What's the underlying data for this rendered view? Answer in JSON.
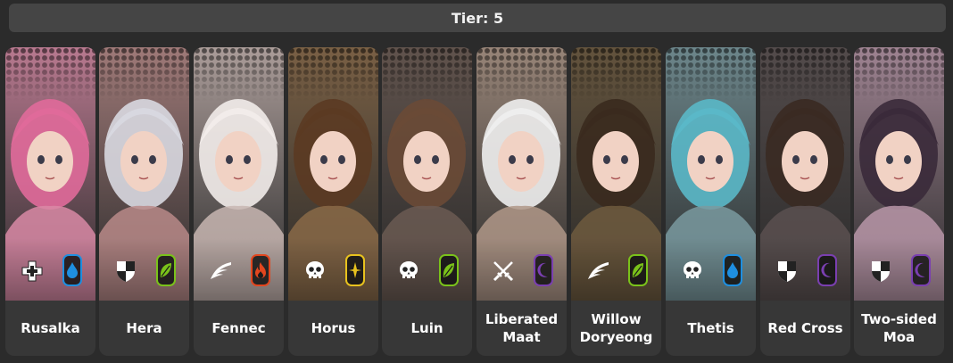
{
  "tier_label": "Tier: 5",
  "characters": [
    {
      "name": "Rusalka",
      "role_icon": "cross-icon",
      "element_icon": "water-drop-icon",
      "element_color": "#1e8fe0",
      "tint": "#d98aa6",
      "hair": "#e06a9a"
    },
    {
      "name": "Hera",
      "role_icon": "half-shield-icon",
      "element_icon": "leaf-icon",
      "element_color": "#7ac21a",
      "tint": "#b98a88",
      "hair": "#d8d8e0"
    },
    {
      "name": "Fennec",
      "role_icon": "wing-icon",
      "element_icon": "fire-icon",
      "element_color": "#e2461e",
      "tint": "#c8b6b2",
      "hair": "#f2ecea"
    },
    {
      "name": "Horus",
      "role_icon": "skull-icon",
      "element_icon": "star-icon",
      "element_color": "#e8c21e",
      "tint": "#8a6a48",
      "hair": "#5b3a22"
    },
    {
      "name": "Luin",
      "role_icon": "skull-icon",
      "element_icon": "leaf-icon",
      "element_color": "#7ac21a",
      "tint": "#6b5a52",
      "hair": "#6a4a36"
    },
    {
      "name": "Liberated\nMaat",
      "role_icon": "crossed-swords-icon",
      "element_icon": "moon-icon",
      "element_color": "#7a3fb0",
      "tint": "#b09888",
      "hair": "#eeeeee"
    },
    {
      "name": "Willow\nDoryeong",
      "role_icon": "wing-icon",
      "element_icon": "leaf-icon",
      "element_color": "#7ac21a",
      "tint": "#6e5a3e",
      "hair": "#3a2a1e"
    },
    {
      "name": "Thetis",
      "role_icon": "skull-icon",
      "element_icon": "water-drop-icon",
      "element_color": "#1e8fe0",
      "tint": "#7a9aa0",
      "hair": "#5ab8c8"
    },
    {
      "name": "Red Cross",
      "role_icon": "half-shield-icon",
      "element_icon": "moon-icon",
      "element_color": "#7a3fb0",
      "tint": "#5a5050",
      "hair": "#3a2a22"
    },
    {
      "name": "Two-sided\nMoa",
      "role_icon": "half-shield-icon",
      "element_icon": "moon-icon",
      "element_color": "#7a3fb0",
      "tint": "#b896a8",
      "hair": "#3a2a3a"
    }
  ]
}
